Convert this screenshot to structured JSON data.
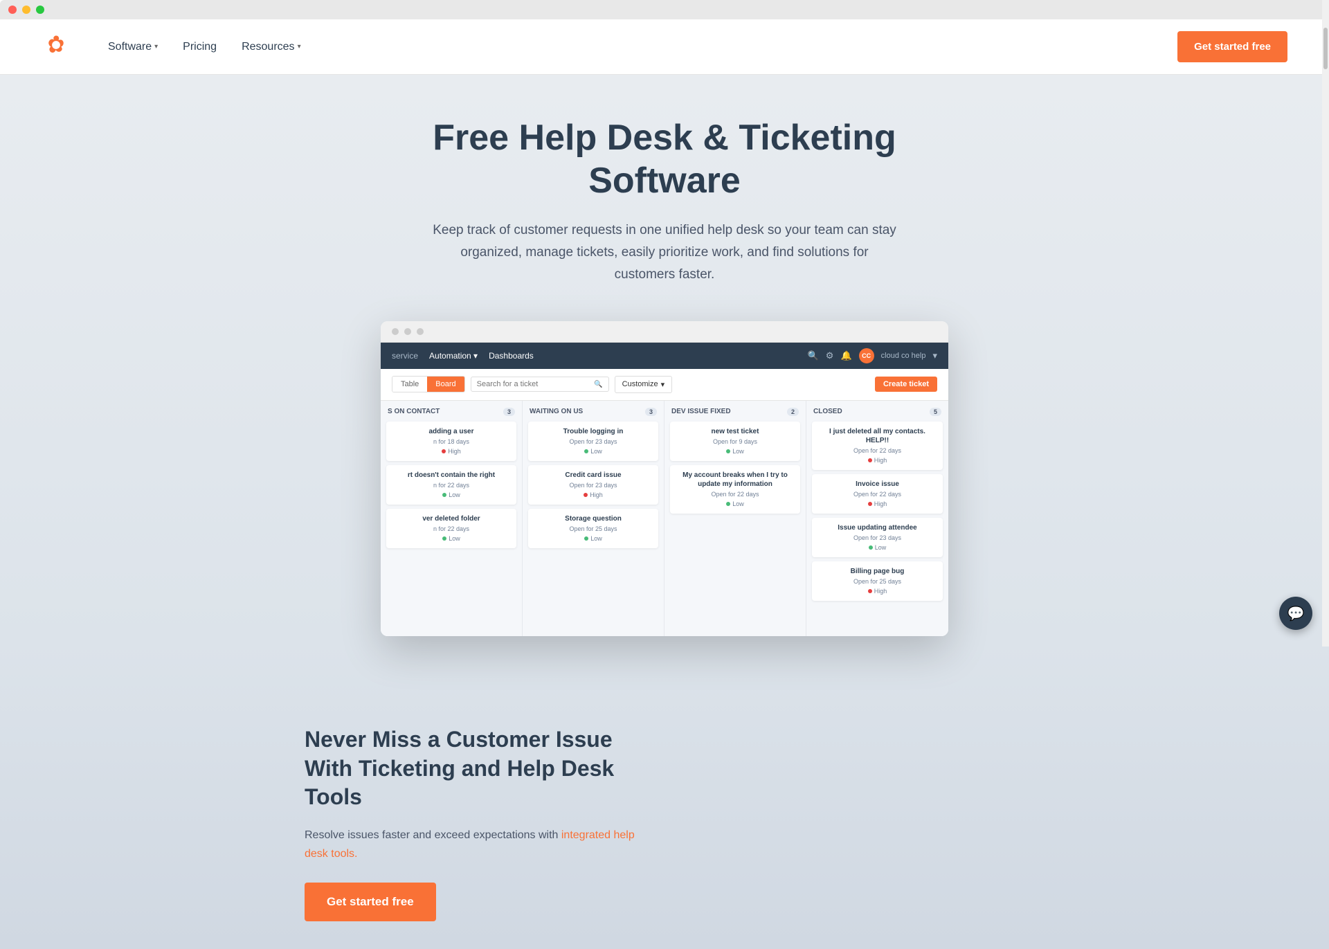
{
  "macChrome": {
    "dots": [
      "red",
      "yellow",
      "green"
    ]
  },
  "navbar": {
    "logo_alt": "HubSpot",
    "nav_items": [
      {
        "label": "Software",
        "has_dropdown": true
      },
      {
        "label": "Pricing",
        "has_dropdown": false
      },
      {
        "label": "Resources",
        "has_dropdown": true
      }
    ],
    "cta_label": "Get started free"
  },
  "hero": {
    "title": "Free Help Desk & Ticketing Software",
    "subtitle": "Keep track of customer requests in one unified help desk so your team can stay organized, manage tickets, easily prioritize work, and find solutions for customers faster."
  },
  "dashboard": {
    "topbar_items": [
      "service",
      "Automation",
      "Dashboards"
    ],
    "user_label": "cloud co help",
    "toolbar": {
      "view_table": "Table",
      "view_board": "Board",
      "search_placeholder": "Search for a ticket",
      "customize_label": "Customize",
      "create_label": "Create ticket"
    },
    "kanban_cols": [
      {
        "title": "S ON CONTACT",
        "count": "3",
        "cards": [
          {
            "title": "adding a user",
            "meta": "n for 18 days",
            "badge": "High",
            "badge_type": "high"
          },
          {
            "title": "rt doesn't contain the right",
            "meta": "n for 22 days",
            "badge": "Low",
            "badge_type": "low"
          },
          {
            "title": "ver deleted folder",
            "meta": "n for 22 days",
            "badge": "Low",
            "badge_type": "low"
          }
        ]
      },
      {
        "title": "WAITING ON US",
        "count": "3",
        "cards": [
          {
            "title": "Trouble logging in",
            "meta": "Open for 23 days",
            "badge": "Low",
            "badge_type": "low"
          },
          {
            "title": "Credit card issue",
            "meta": "Open for 23 days",
            "badge": "High",
            "badge_type": "high"
          },
          {
            "title": "Storage question",
            "meta": "Open for 25 days",
            "badge": "Low",
            "badge_type": "low"
          }
        ]
      },
      {
        "title": "DEV ISSUE FIXED",
        "count": "2",
        "cards": [
          {
            "title": "new test ticket",
            "meta": "Open for 9 days",
            "badge": "Low",
            "badge_type": "low"
          },
          {
            "title": "My account breaks when I try to update my information",
            "meta": "Open for 22 days",
            "badge": "Low",
            "badge_type": "low"
          }
        ]
      },
      {
        "title": "CLOSED",
        "count": "5",
        "cards": [
          {
            "title": "I just deleted all my contacts. HELP!!",
            "meta": "Open for 22 days",
            "badge": "High",
            "badge_type": "high"
          },
          {
            "title": "Invoice issue",
            "meta": "Open for 22 days",
            "badge": "High",
            "badge_type": "high"
          },
          {
            "title": "Issue updating attendee",
            "meta": "Open for 23 days",
            "badge": "Low",
            "badge_type": "low"
          },
          {
            "title": "Billing page bug",
            "meta": "Open for 25 days",
            "badge": "High",
            "badge_type": "high"
          }
        ]
      }
    ]
  },
  "content": {
    "heading": "Never Miss a Customer Issue With Ticketing and Help Desk Tools",
    "body": "Resolve issues faster and exceed expectations with integrated help desk tools.",
    "link_text": "integrated help desk tools.",
    "cta_label": "Get started free"
  },
  "chat": {
    "icon": "💬"
  }
}
